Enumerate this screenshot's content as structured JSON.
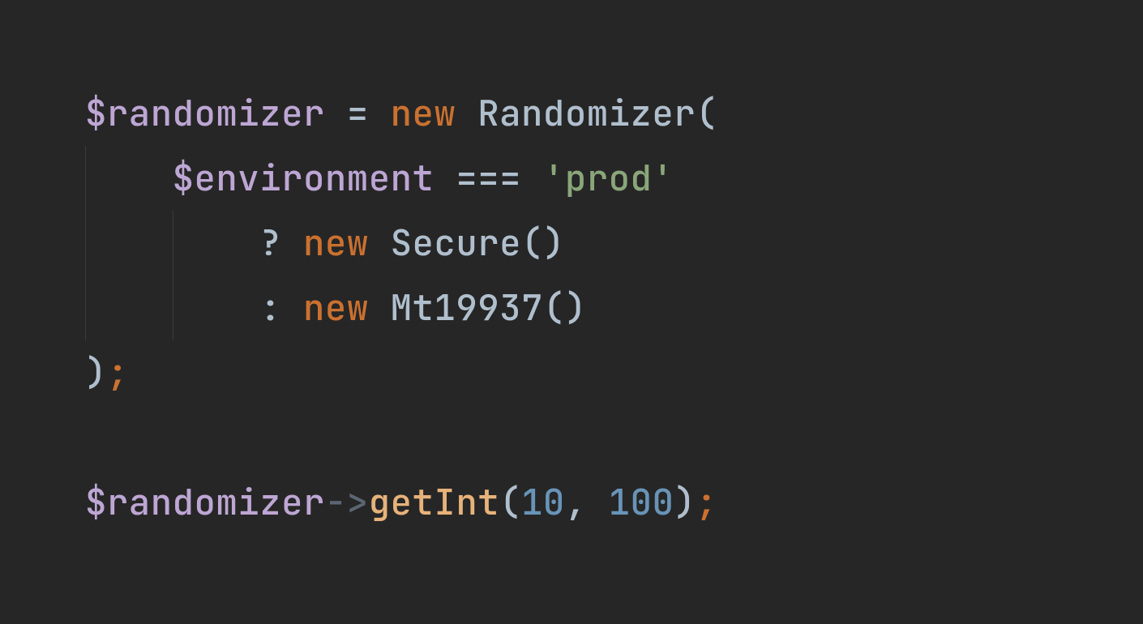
{
  "colors": {
    "background": "#262626",
    "variable": "#bda6d4",
    "operator": "#b0bfcd",
    "keyword": "#cb7130",
    "class": "#b0bfcd",
    "punct": "#b0bfcd",
    "string": "#8aa67a",
    "method": "#e7b27a",
    "number": "#6894b8",
    "semi": "#cb7130",
    "arrow": "#5b6672"
  },
  "indent_guides": true,
  "lines": [
    {
      "indent": 0,
      "tokens": [
        {
          "text": "$randomizer",
          "cls": "variable"
        },
        {
          "text": " ",
          "cls": "space"
        },
        {
          "text": "=",
          "cls": "operator"
        },
        {
          "text": " ",
          "cls": "space"
        },
        {
          "text": "new",
          "cls": "keyword"
        },
        {
          "text": " ",
          "cls": "space"
        },
        {
          "text": "Randomizer",
          "cls": "class"
        },
        {
          "text": "(",
          "cls": "punct"
        }
      ]
    },
    {
      "indent": 1,
      "tokens": [
        {
          "text": "$environment",
          "cls": "variable"
        },
        {
          "text": " ",
          "cls": "space"
        },
        {
          "text": "===",
          "cls": "operator"
        },
        {
          "text": " ",
          "cls": "space"
        },
        {
          "text": "'prod'",
          "cls": "string"
        }
      ]
    },
    {
      "indent": 2,
      "tokens": [
        {
          "text": "?",
          "cls": "operator"
        },
        {
          "text": " ",
          "cls": "space"
        },
        {
          "text": "new",
          "cls": "keyword"
        },
        {
          "text": " ",
          "cls": "space"
        },
        {
          "text": "Secure",
          "cls": "class"
        },
        {
          "text": "()",
          "cls": "punct"
        }
      ]
    },
    {
      "indent": 2,
      "tokens": [
        {
          "text": ":",
          "cls": "operator"
        },
        {
          "text": " ",
          "cls": "space"
        },
        {
          "text": "new",
          "cls": "keyword"
        },
        {
          "text": " ",
          "cls": "space"
        },
        {
          "text": "Mt19937",
          "cls": "class"
        },
        {
          "text": "()",
          "cls": "punct"
        }
      ]
    },
    {
      "indent": 0,
      "tokens": [
        {
          "text": ")",
          "cls": "punct"
        },
        {
          "text": ";",
          "cls": "semi"
        }
      ]
    },
    {
      "indent": 0,
      "tokens": []
    },
    {
      "indent": 0,
      "tokens": [
        {
          "text": "$randomizer",
          "cls": "variable"
        },
        {
          "text": "->",
          "cls": "arrow"
        },
        {
          "text": "getInt",
          "cls": "method"
        },
        {
          "text": "(",
          "cls": "punct"
        },
        {
          "text": "10",
          "cls": "number"
        },
        {
          "text": ",",
          "cls": "punct"
        },
        {
          "text": " ",
          "cls": "space"
        },
        {
          "text": "100",
          "cls": "number"
        },
        {
          "text": ")",
          "cls": "punct"
        },
        {
          "text": ";",
          "cls": "semi"
        }
      ]
    }
  ]
}
